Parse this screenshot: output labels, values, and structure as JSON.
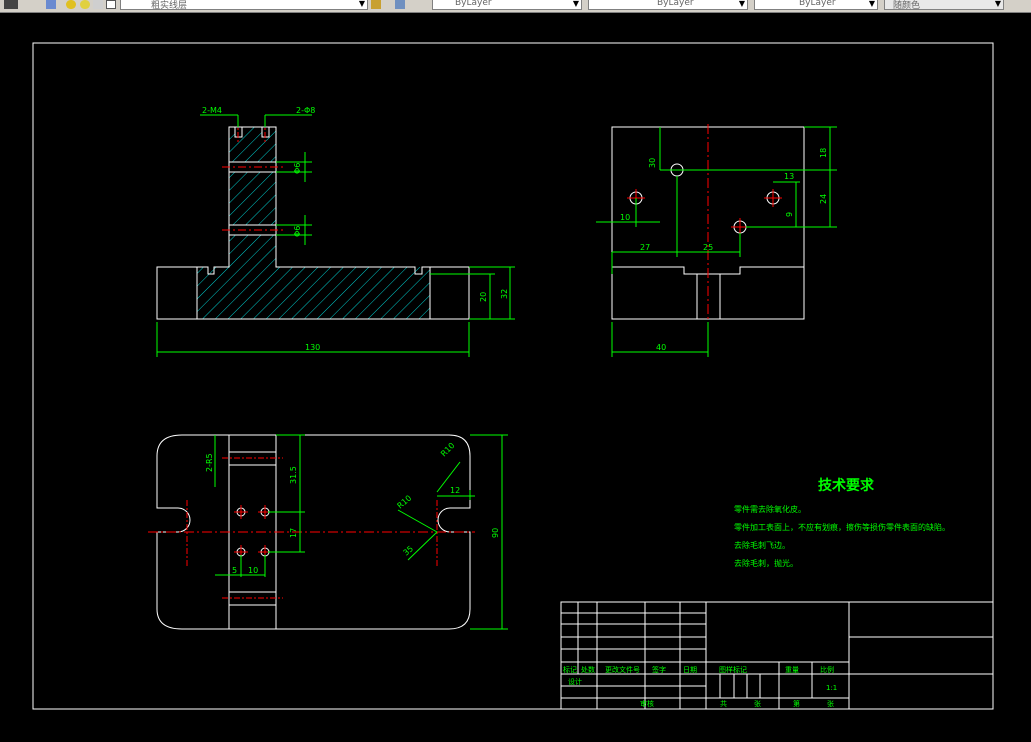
{
  "toolbar": {
    "layer_name": "粗实线层",
    "color_control": "ByLayer",
    "linetype_control": "ByLayer",
    "lineweight_control": "ByLayer",
    "plotstyle_control": "随颜色"
  },
  "drawing": {
    "front_view_dims": {
      "tap_callout": "2-M4",
      "hole_callout": "2-Φ8",
      "dia_upper": "Φ6",
      "dia_lower": "Φ6",
      "height_inner": "20",
      "height_outer": "32",
      "overall_width": "130"
    },
    "side_view_dims": {
      "d30": "30",
      "d18": "18",
      "d24": "24",
      "d13": "13",
      "d9": "9",
      "d10": "10",
      "d27": "27",
      "d25": "25",
      "d40": "40"
    },
    "top_view_dims": {
      "corner_radius": "2-R5",
      "d31_5": "31.5",
      "d17": "17",
      "d5": "5",
      "d10": "10",
      "r10": "R10",
      "d90": "90",
      "r10_slot": "R10",
      "d12": "12",
      "d35": "35"
    },
    "tech_requirements": {
      "title": "技术要求",
      "lines": [
        "零件需去除氧化皮。",
        "零件加工表面上，不应有划痕，擦伤等损伤零件表面的缺陷。",
        "去除毛刺飞边。",
        "去除毛刺，抛光。"
      ]
    },
    "title_block": {
      "row_labels": [
        "标记",
        "处数",
        "更改文件号",
        "签字",
        "日期"
      ],
      "design": "设计",
      "stage_labels": [
        "图样标记",
        "重量",
        "比例"
      ],
      "scale": "1:1",
      "review": "审核",
      "total": "共",
      "sheet": "张",
      "page": "第",
      "page_sheet": "张"
    }
  },
  "colors": {
    "background": "#000000",
    "outline": "#ffffff",
    "dimension": "#00ff00",
    "centerline": "#ff0000",
    "hatch": "#00cccc",
    "text_green": "#00ff00"
  }
}
